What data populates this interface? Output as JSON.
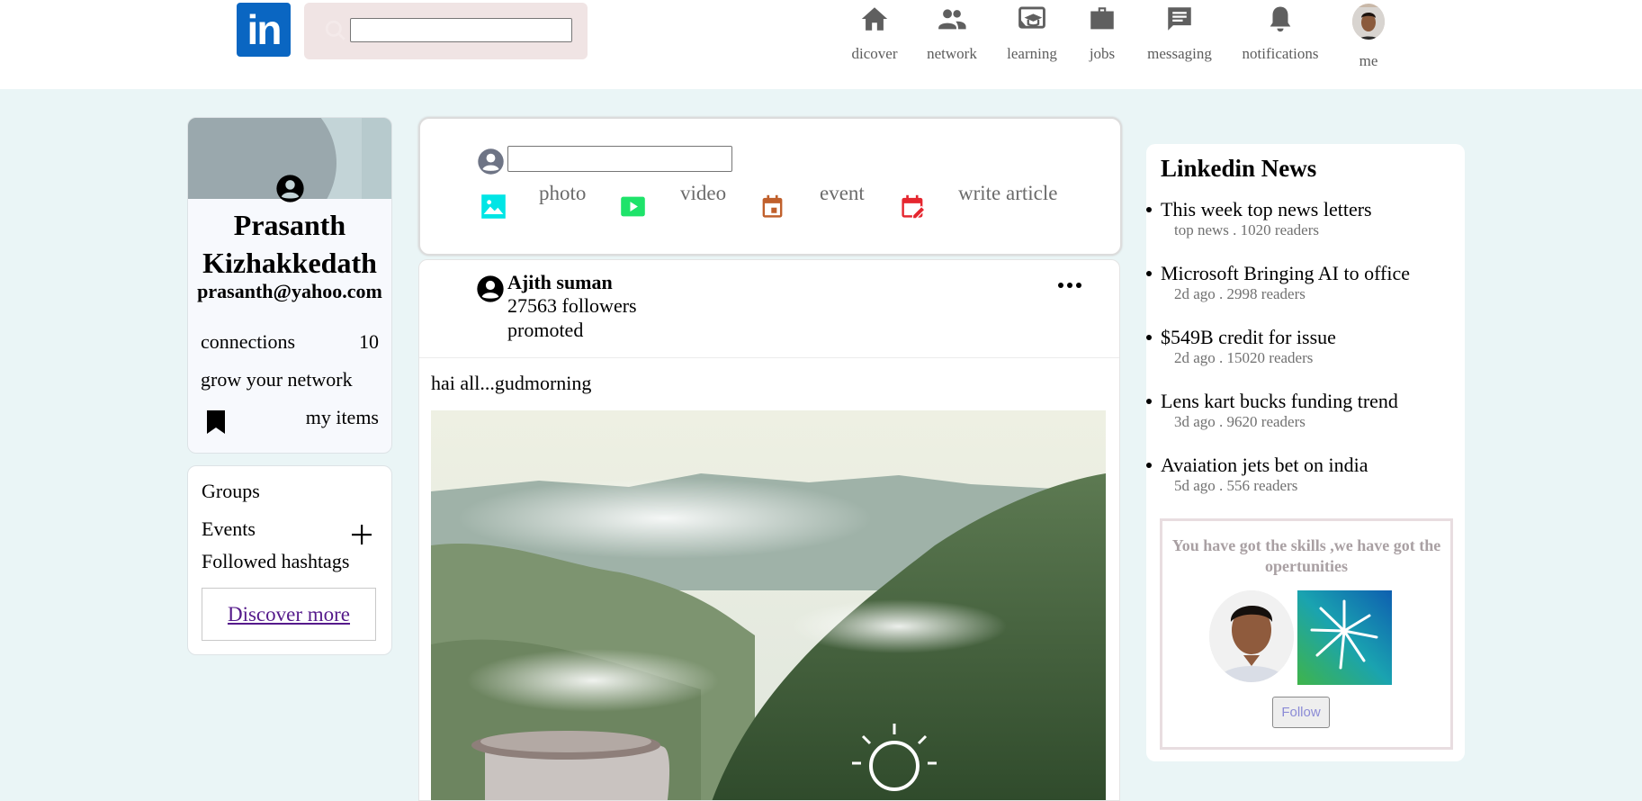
{
  "header": {
    "logo_text": "in",
    "nav": [
      {
        "label": "dicover",
        "icon": "home-icon"
      },
      {
        "label": "network",
        "icon": "people-icon"
      },
      {
        "label": "learning",
        "icon": "learning-icon"
      },
      {
        "label": "jobs",
        "icon": "briefcase-icon"
      },
      {
        "label": "messaging",
        "icon": "message-icon"
      },
      {
        "label": "notifications",
        "icon": "bell-icon"
      },
      {
        "label": "me",
        "icon": "avatar"
      }
    ],
    "search": {
      "placeholder": ""
    }
  },
  "profile": {
    "name": "Prasanth Kizhakkedath",
    "email": "prasanth@yahoo.com",
    "connections_label": "connections",
    "connections_count": "10",
    "grow_label": "grow your network",
    "items_label": "my items"
  },
  "groups": {
    "groups_label": "Groups",
    "events_label": "Events",
    "hashtags_label": "Followed hashtags",
    "discover_label": "Discover more"
  },
  "composer": {
    "placeholder": "",
    "actions": [
      {
        "label": "photo",
        "icon": "photo-icon",
        "color": "#00e5e5"
      },
      {
        "label": "video",
        "icon": "video-icon",
        "color": "#1ee36a"
      },
      {
        "label": "event",
        "icon": "calendar-icon",
        "color": "#c0602c"
      },
      {
        "label": "write article",
        "icon": "article-icon",
        "color": "#e5262f"
      }
    ]
  },
  "post": {
    "author": "Ajith suman",
    "followers": "27563 followers",
    "promoted": "promoted",
    "text": "hai all...gudmorning"
  },
  "news": {
    "title": "Linkedin News",
    "items": [
      {
        "headline": "This week top news letters",
        "meta": "top news . 1020 readers"
      },
      {
        "headline": "Microsoft Bringing AI to office",
        "meta": "2d ago . 2998 readers"
      },
      {
        "headline": "$549B credit for issue",
        "meta": "2d ago . 15020 readers"
      },
      {
        "headline": "Lens kart bucks funding trend",
        "meta": "3d ago . 9620 readers"
      },
      {
        "headline": "Avaiation jets bet on india",
        "meta": "5d ago . 556 readers"
      }
    ],
    "promo": {
      "text": "You have got the skills ,we have got the opertunities",
      "follow_label": "Follow"
    }
  },
  "colors": {
    "brand": "#0a66c2",
    "page_bg": "#eaf5f6",
    "search_bg": "#f0e4e4"
  }
}
